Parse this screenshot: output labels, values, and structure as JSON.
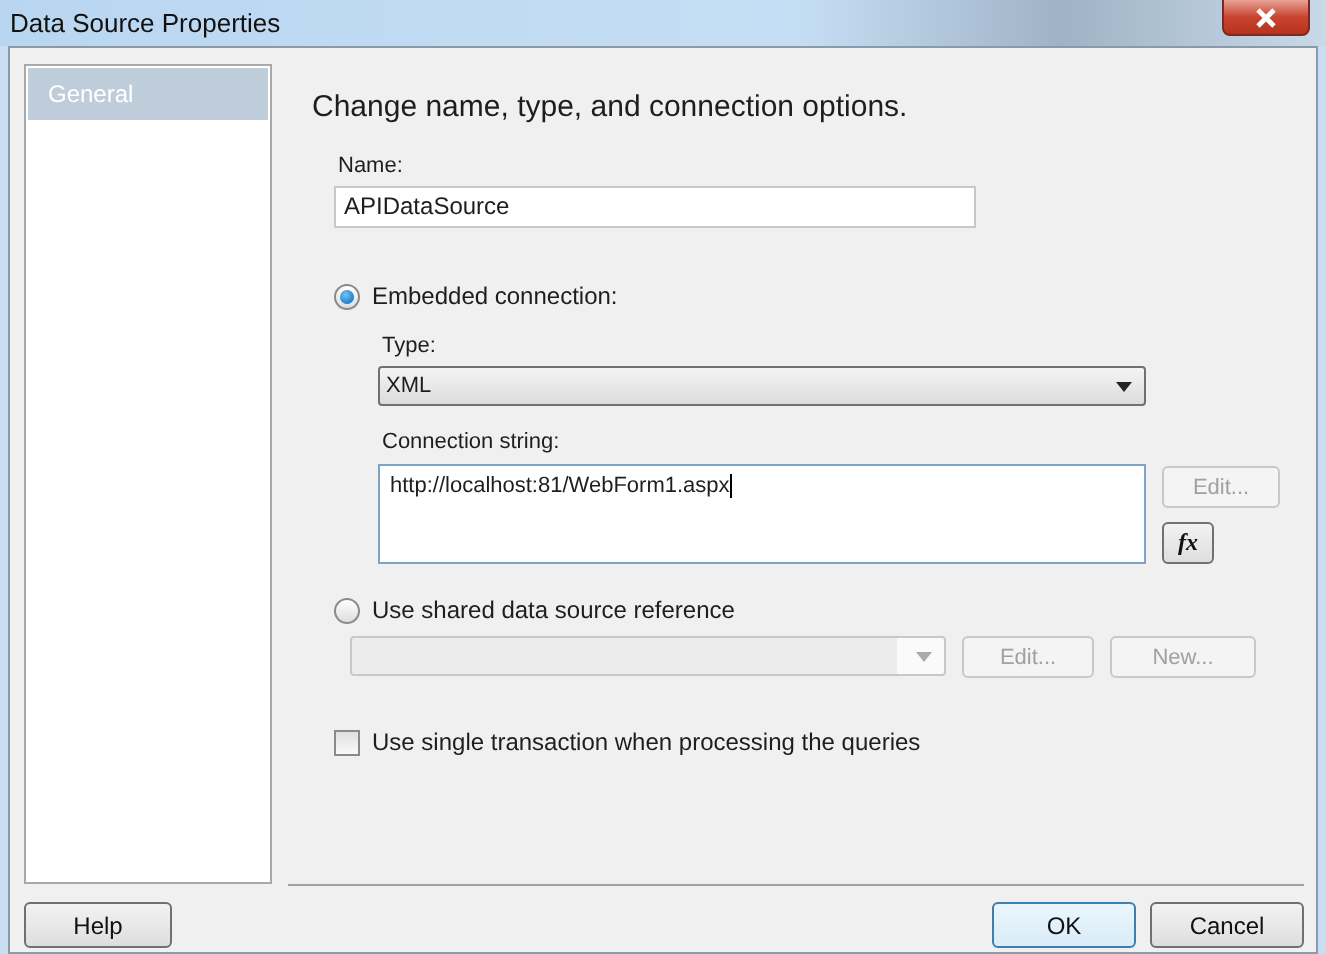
{
  "window": {
    "title": "Data Source Properties"
  },
  "sidebar": {
    "items": [
      {
        "label": "General",
        "selected": true
      }
    ]
  },
  "heading": "Change name, type, and connection options.",
  "name": {
    "label": "Name:",
    "value": "APIDataSource"
  },
  "embedded": {
    "label": "Embedded connection:",
    "selected": true,
    "type": {
      "label": "Type:",
      "value": "XML"
    },
    "connection_string": {
      "label": "Connection string:",
      "value": "http://localhost:81/WebForm1.aspx"
    },
    "edit_button": {
      "label": "Edit...",
      "disabled": true
    },
    "expression_button": {
      "label": "fx"
    }
  },
  "shared": {
    "label": "Use shared data source reference",
    "selected": false,
    "edit_button": {
      "label": "Edit...",
      "disabled": true
    },
    "new_button": {
      "label": "New...",
      "disabled": true
    }
  },
  "single_transaction": {
    "label": "Use single transaction when processing the queries",
    "checked": false
  },
  "buttons": {
    "help": "Help",
    "ok": "OK",
    "cancel": "Cancel"
  }
}
